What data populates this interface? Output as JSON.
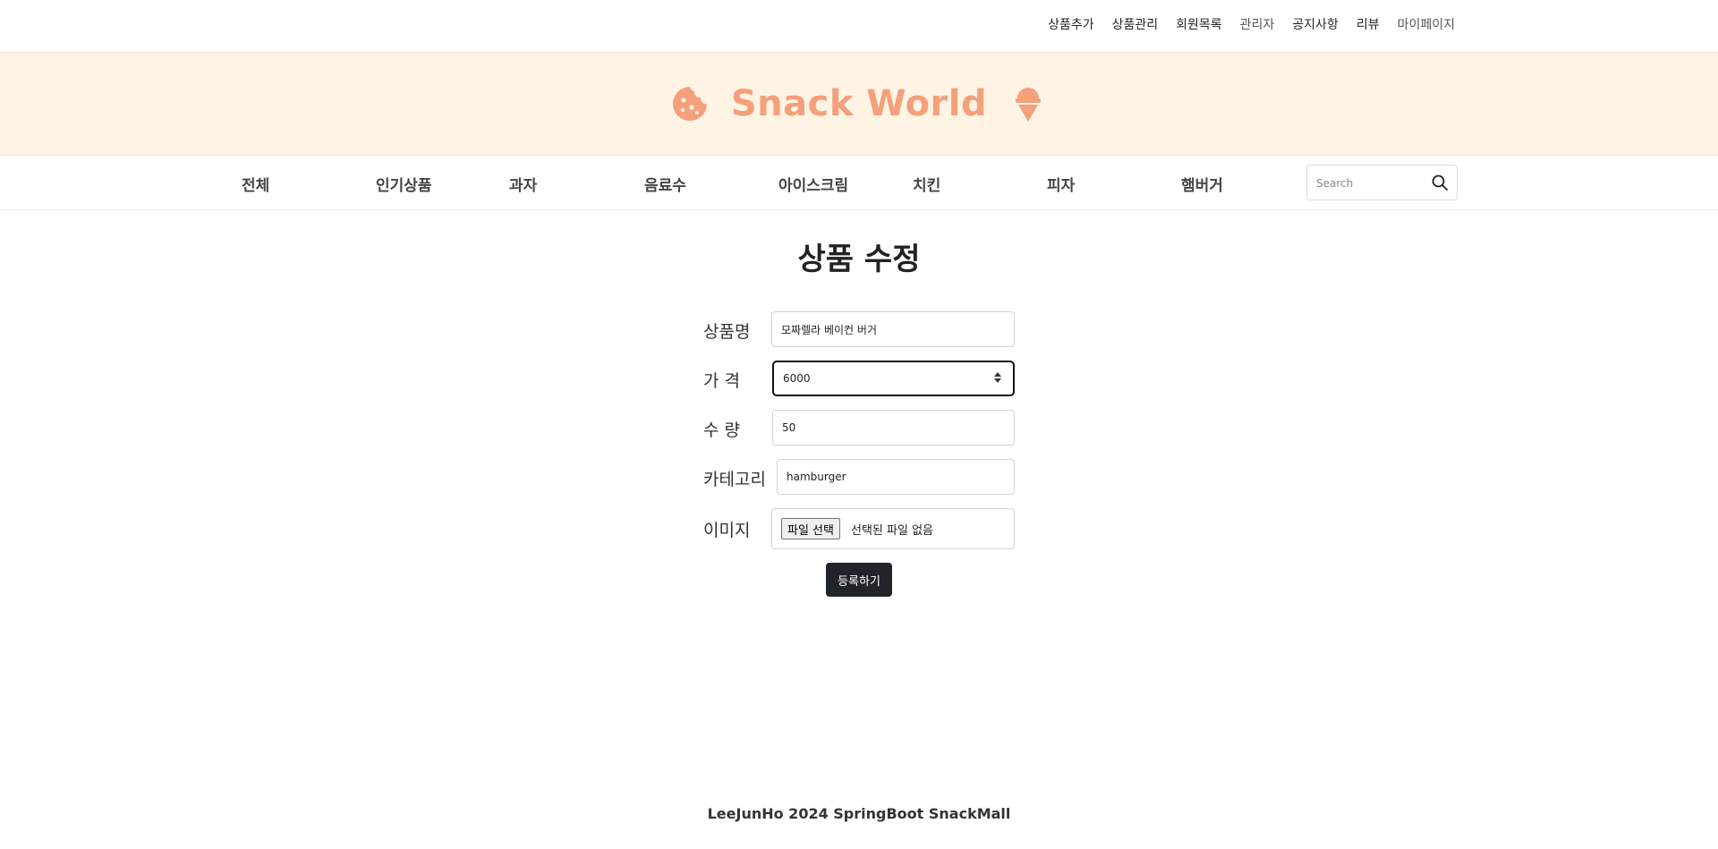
{
  "topnav": {
    "links": [
      "상품추가",
      "상품관리",
      "회원목록",
      "관리자",
      "공지사항",
      "리뷰",
      "마이페이지"
    ]
  },
  "brand": {
    "title": "Snack World",
    "color": "#f4a07a",
    "left_icon": "cookie-icon",
    "right_icon": "ice-cream-icon"
  },
  "categories": [
    "전체",
    "인기상품",
    "과자",
    "음료수",
    "아이스크림",
    "치킨",
    "피자",
    "햄버거"
  ],
  "search": {
    "placeholder": "Search",
    "icon": "search-icon"
  },
  "form": {
    "title": "상품 수정",
    "name_label": "상품명",
    "name_value": "모짜렐라 베이컨 버거",
    "price_label": "가 격",
    "price_value": "6000",
    "quantity_label": "수 량",
    "quantity_value": "50",
    "category_label": "카테고리",
    "category_value": "hamburger",
    "image_label": "이미지",
    "file_button": "파일 선택",
    "file_status": "선택된 파일 없음",
    "submit": "등록하기"
  },
  "footer": {
    "text": "LeeJunHo 2024 SpringBoot SnackMall"
  }
}
